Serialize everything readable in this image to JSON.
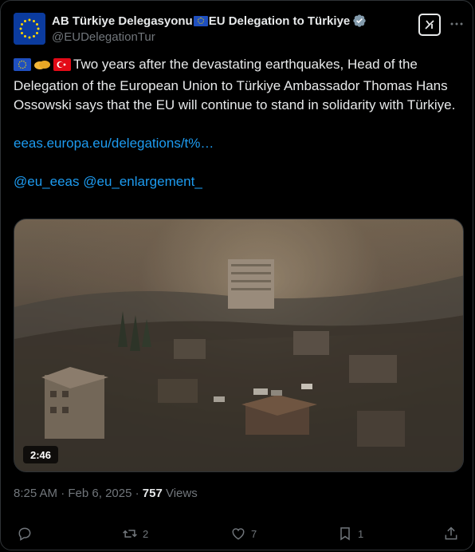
{
  "account": {
    "name_part1": "AB Türkiye Delegasyonu",
    "name_part2": "EU Delegation to Türkiye",
    "handle": "@EUDelegationTur"
  },
  "tweet": {
    "text_line": "Two years after the devastating earthquakes, Head of the Delegation of the European Union to Türkiye Ambassador Thomas Hans Ossowski says that the EU will continue to stand in solidarity with Türkiye.",
    "link": "eeas.europa.eu/delegations/t%…",
    "mention1": "@eu_eeas",
    "mention2": "@eu_enlargement_"
  },
  "media": {
    "duration": "2:46",
    "description_icon": "video-thumbnail"
  },
  "meta": {
    "time": "8:25 AM",
    "separator": " · ",
    "date": "Feb 6, 2025",
    "views_count": "757",
    "views_label": " Views"
  },
  "actions": {
    "replies": "",
    "reposts": "2",
    "likes": "7",
    "bookmarks": "1"
  },
  "colors": {
    "accent_link": "#1d9bf0",
    "muted": "#71767b",
    "text": "#e7e9ea",
    "verified": "#829aab"
  },
  "icons": [
    "eu-flag-avatar",
    "verified-badge-icon",
    "grok-icon",
    "more-icon",
    "eu-flag-emoji",
    "handshake-emoji",
    "turkey-flag-emoji",
    "reply-icon",
    "repost-icon",
    "like-icon",
    "bookmark-icon",
    "share-icon"
  ]
}
